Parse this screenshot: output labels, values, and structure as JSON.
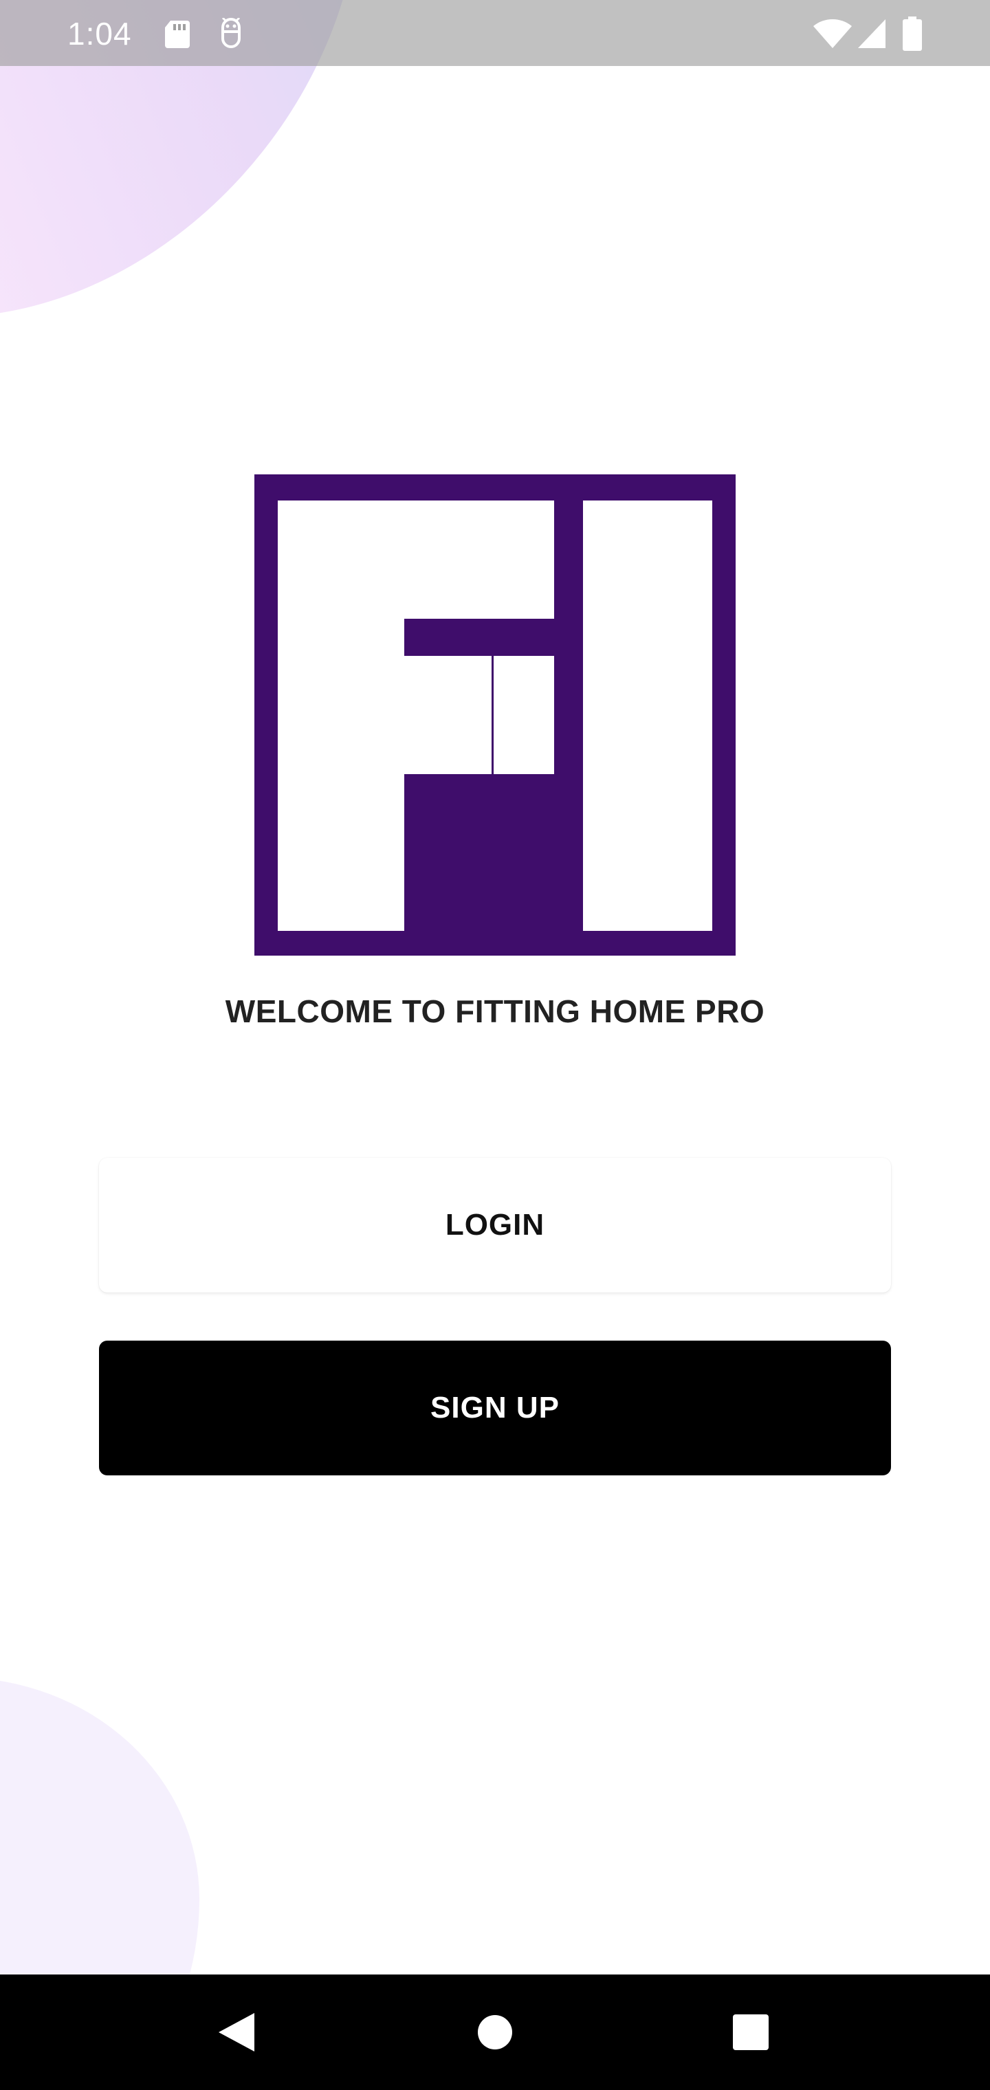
{
  "status_bar": {
    "time": "1:04",
    "icons": [
      "sd-card-icon",
      "debug-icon",
      "wifi-icon",
      "signal-icon",
      "battery-icon"
    ]
  },
  "logo": {
    "name": "fitting-home-pro-logo",
    "color": "#3f0d6b"
  },
  "welcome": {
    "text": "WELCOME TO FITTING HOME PRO"
  },
  "buttons": {
    "login": "LOGIN",
    "signup": "SIGN UP"
  },
  "nav_bar": {
    "icons": [
      "back-icon",
      "home-icon",
      "recents-icon"
    ]
  },
  "colors": {
    "brand": "#3f0d6b",
    "signup_bg": "#000000",
    "login_bg": "#ffffff"
  }
}
